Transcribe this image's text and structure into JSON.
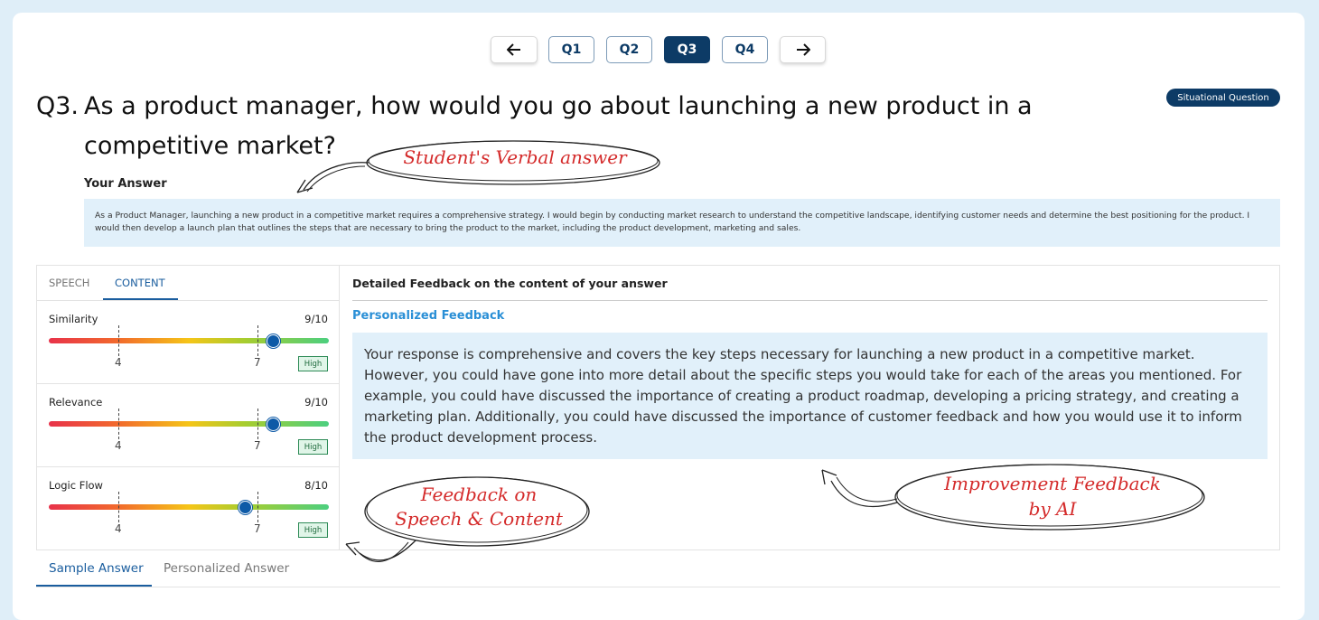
{
  "nav": {
    "prev_icon": "arrow-left-icon",
    "next_icon": "arrow-right-icon",
    "questions": [
      "Q1",
      "Q2",
      "Q3",
      "Q4"
    ],
    "active": "Q3"
  },
  "question": {
    "number": "Q3.",
    "text": "As a product manager, how would you go about launching a new product in a competitive market?",
    "badge": "Situational Question"
  },
  "answer": {
    "label": "Your Answer",
    "text": "As a Product Manager, launching a new product in a competitive market requires a comprehensive strategy. I would begin by conducting market research to understand the competitive landscape, identifying customer needs and determine the best positioning for the product. I would then develop a launch plan that outlines the steps that are necessary to bring the product to the market, including the product development, marketing and sales."
  },
  "score_panel": {
    "tabs": [
      "SPEECH",
      "CONTENT"
    ],
    "active_tab": "CONTENT",
    "metrics": [
      {
        "name": "Similarity",
        "score": "9/10",
        "level": 9,
        "tick1": "4",
        "tick2": "7",
        "tag": "High"
      },
      {
        "name": "Relevance",
        "score": "9/10",
        "level": 9,
        "tick1": "4",
        "tick2": "7",
        "tag": "High"
      },
      {
        "name": "Logic Flow",
        "score": "8/10",
        "level": 8,
        "tick1": "4",
        "tick2": "7",
        "tag": "High"
      }
    ]
  },
  "feedback": {
    "title": "Detailed Feedback on the content of your answer",
    "subtitle": "Personalized Feedback",
    "text": "Your response is comprehensive and covers the key steps necessary for launching a new product in a competitive market. However, you could have gone into more detail about the specific steps you would take for each of the areas you mentioned. For example, you could have discussed the importance of creating a product roadmap, developing a pricing strategy, and creating a marketing plan. Additionally, you could have discussed the importance of customer feedback and how you would use it to inform the product development process."
  },
  "bottom_tabs": {
    "sample": "Sample Answer",
    "personalized": "Personalized Answer"
  },
  "annotations": {
    "verbal": "Student's Verbal answer",
    "feedback_line1": "Feedback on",
    "feedback_line2": "Speech & Content",
    "improve_line1": "Improvement Feedback",
    "improve_line2": "by AI"
  },
  "colors": {
    "primary": "#0d3b66",
    "accent_blue": "#2a8fd6",
    "panel_bg": "#e1f0fa",
    "annotation_red": "#d42a2a"
  }
}
